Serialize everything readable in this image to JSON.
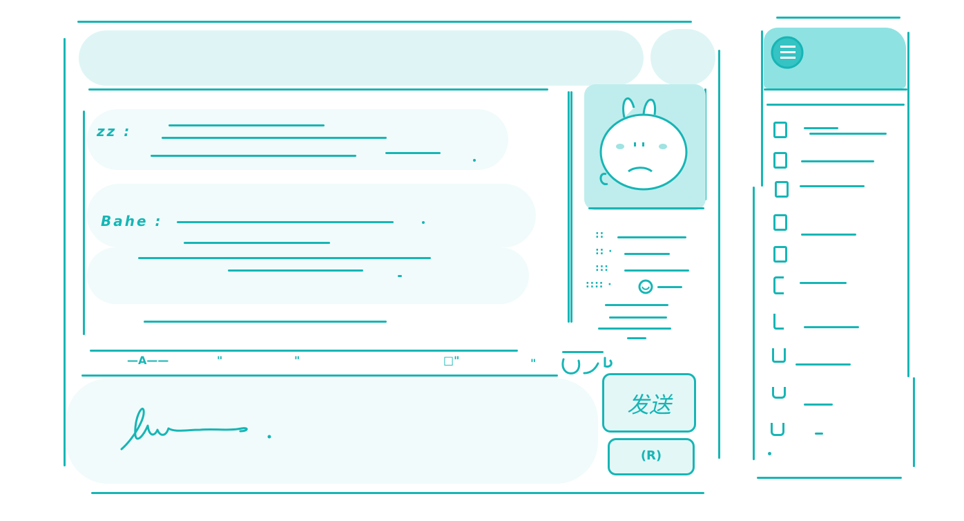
{
  "chat": {
    "messages": [
      {
        "sender": "zz :"
      },
      {
        "sender": "Bahe :"
      }
    ]
  },
  "toolbar": {
    "font_label": "—A——",
    "glyph_2": "\"",
    "glyph_3": "\"",
    "glyph_4": "□\"",
    "glyph_5": "\""
  },
  "actions": {
    "send_label": "发送",
    "record_label": "(R)"
  },
  "profile": {
    "info_rows": [
      "::",
      ":: ·",
      ":::",
      ":::: ·"
    ]
  },
  "icons": [
    "menu-icon",
    "smiley-icon",
    "emoji-icon",
    "bunny-avatar"
  ],
  "colors": {
    "accent": "#17b5b5",
    "panel": "#dff5f5",
    "soft": "#f1fbfb"
  }
}
